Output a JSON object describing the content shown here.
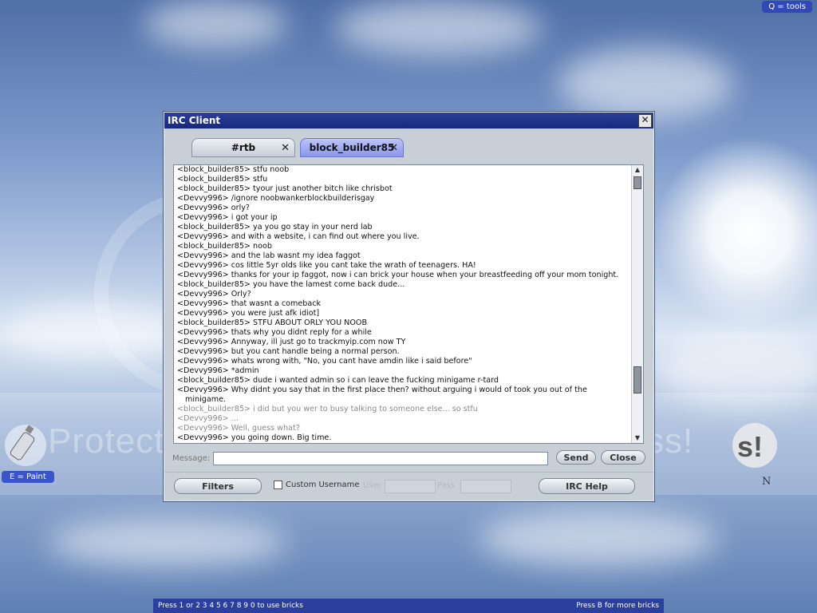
{
  "hud": {
    "tools_hint": "Q = tools",
    "paint_hint": "E = Paint",
    "bottom_left": "Press 1 or  2 3 4 5 6 7 8 9 0 to use bricks",
    "bottom_right": "Press B for more bricks",
    "corner_letter": "N"
  },
  "watermark": {
    "text": "Protect more of your memories for less!"
  },
  "window": {
    "title": "IRC Client",
    "close_glyph": "✕",
    "tabs": [
      {
        "label": "#rtb",
        "close": "✕",
        "active": false
      },
      {
        "label": "block_builder85",
        "close": "✕",
        "active": true
      }
    ],
    "chat_lines": [
      {
        "text": "<block_builder85> stfu noob",
        "dim": false
      },
      {
        "text": "<block_builder85> stfu",
        "dim": false
      },
      {
        "text": "<block_builder85> tyour just another bitch like chrisbot",
        "dim": false
      },
      {
        "text": "<Devvy996>  /ignore noobwankerblockbuilderisgay",
        "dim": false
      },
      {
        "text": "<Devvy996> orly?",
        "dim": false
      },
      {
        "text": "<Devvy996> i got your ip",
        "dim": false
      },
      {
        "text": "<block_builder85> ya you go stay in your nerd lab",
        "dim": false
      },
      {
        "text": "<Devvy996> and with a website, i can find out where you live.",
        "dim": false
      },
      {
        "text": "<block_builder85> noob",
        "dim": false
      },
      {
        "text": "<Devvy996> and the lab wasnt my idea faggot",
        "dim": false
      },
      {
        "text": "<Devvy996> cos little 5yr olds like you cant take the wrath of teenagers. HA!",
        "dim": false
      },
      {
        "text": "<Devvy996> thanks for your ip faggot, now i can brick your house when your breastfeeding off your mom tonight.",
        "dim": false
      },
      {
        "text": "<block_builder85> you have the lamest come back dude...",
        "dim": false
      },
      {
        "text": "<Devvy996> Orly?",
        "dim": false
      },
      {
        "text": "<Devvy996> that wasnt a comeback",
        "dim": false
      },
      {
        "text": "<Devvy996> you were just afk idiot]",
        "dim": false
      },
      {
        "text": "<block_builder85> STFU ABOUT ORLY YOU NOOB",
        "dim": false
      },
      {
        "text": "<Devvy996> thats why you didnt reply for a while",
        "dim": false
      },
      {
        "text": "<Devvy996> Annyway, ill just go to trackmyip.com now TY",
        "dim": false
      },
      {
        "text": "<Devvy996> but you cant handle being a normal person.",
        "dim": false
      },
      {
        "text": "<Devvy996> whats wrong with, \"No, you cant have amdin like i said before\"",
        "dim": false
      },
      {
        "text": "<Devvy996> *admin",
        "dim": false
      },
      {
        "text": "<block_builder85> dude i wanted admin so i can leave the fucking minigame r-tard",
        "dim": false
      },
      {
        "text": "<Devvy996> Why didnt you say that in the first place then? without arguing i would of took you out of the",
        "dim": false,
        "cont": "minigame."
      },
      {
        "text": "<block_builder85> i did but you wer to busy talking to someone else... so stfu",
        "dim": true
      },
      {
        "text": "<Devvy996> ...",
        "dim": true
      },
      {
        "text": "<Devvy996> Well, guess what?",
        "dim": true
      },
      {
        "text": "<Devvy996> you going down. Big time.",
        "dim": false
      }
    ],
    "message_label": "Message:",
    "message_value": "",
    "send_label": "Send",
    "close_label": "Close",
    "filters_label": "Filters",
    "custom_username_label": "Custom Username",
    "user_label": "User",
    "pass_label": "Pass",
    "irc_help_label": "IRC Help"
  }
}
